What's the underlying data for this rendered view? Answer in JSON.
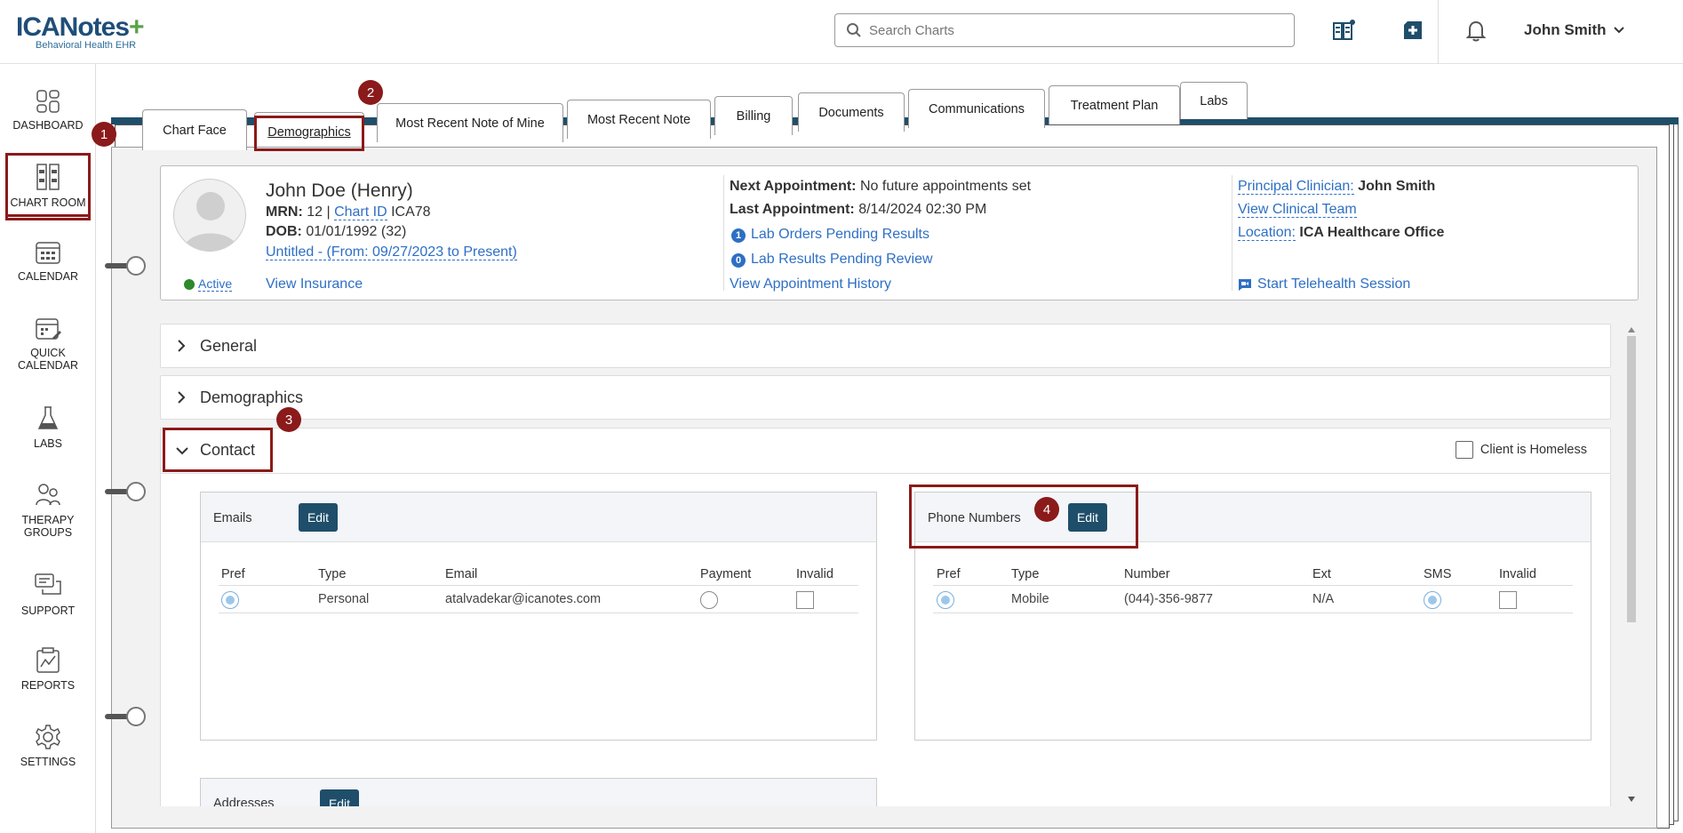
{
  "header": {
    "logo_text": "ICANotes",
    "logo_plus": "+",
    "logo_sub": "Behavioral Health EHR",
    "search_placeholder": "Search Charts",
    "user_name": "John Smith"
  },
  "sidebar": {
    "items": [
      {
        "label": "DASHBOARD"
      },
      {
        "label": "CHART ROOM"
      },
      {
        "label": "CALENDAR"
      },
      {
        "label": "QUICK CALENDAR"
      },
      {
        "label": "LABS"
      },
      {
        "label": "THERAPY GROUPS"
      },
      {
        "label": "SUPPORT"
      },
      {
        "label": "REPORTS"
      },
      {
        "label": "SETTINGS"
      }
    ]
  },
  "tabs": [
    {
      "label": "Chart Face"
    },
    {
      "label": "Demographics"
    },
    {
      "label": "Most Recent Note of Mine"
    },
    {
      "label": "Most Recent Note"
    },
    {
      "label": "Billing"
    },
    {
      "label": "Documents"
    },
    {
      "label": "Communications"
    },
    {
      "label": "Treatment Plan"
    },
    {
      "label": "Labs"
    }
  ],
  "patient": {
    "name": "John Doe (Henry)",
    "mrn_label": "MRN:",
    "mrn_value": "12",
    "sep": "|",
    "chart_id_label": "Chart ID",
    "chart_id_value": "ICA78",
    "dob_label": "DOB:",
    "dob_value": "01/01/1992 (32)",
    "episode": "Untitled - (From: 09/27/2023 to Present)",
    "status": "Active",
    "view_insurance": "View Insurance",
    "next_appt_label": "Next Appointment:",
    "next_appt_value": "No future appointments set",
    "last_appt_label": "Last Appointment:",
    "last_appt_value": "8/14/2024 02:30 PM",
    "lab_orders_count": "1",
    "lab_orders": "Lab Orders Pending Results",
    "lab_results_count": "0",
    "lab_results": "Lab Results Pending Review",
    "view_appt_history": "View Appointment History",
    "principal_label": "Principal Clinician:",
    "principal_value": "John Smith",
    "view_team": "View Clinical Team",
    "location_label": "Location:",
    "location_value": "ICA Healthcare Office",
    "telehealth": "Start Telehealth Session"
  },
  "sections": {
    "general": "General",
    "demographics": "Demographics",
    "contact": "Contact",
    "homeless_label": "Client is Homeless"
  },
  "emails": {
    "title": "Emails",
    "edit": "Edit",
    "headers": [
      "Pref",
      "Type",
      "Email",
      "Payment",
      "Invalid"
    ],
    "row": {
      "type": "Personal",
      "email": "atalvadekar@icanotes.com"
    }
  },
  "phones": {
    "title": "Phone Numbers",
    "edit": "Edit",
    "headers": [
      "Pref",
      "Type",
      "Number",
      "Ext",
      "SMS",
      "Invalid"
    ],
    "row": {
      "type": "Mobile",
      "number": "(044)-356-9877",
      "ext": "N/A"
    }
  },
  "addresses": {
    "title": "Addresses",
    "edit": "Edit"
  },
  "markers": [
    "1",
    "2",
    "3",
    "4"
  ]
}
